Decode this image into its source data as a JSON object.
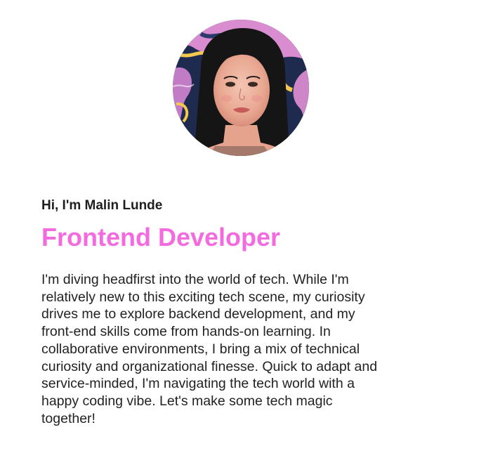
{
  "profile": {
    "greeting": "Hi, I'm Malin Lunde",
    "role": "Frontend Developer",
    "bio": "I'm diving headfirst into the world of tech. While I'm relatively new to this exciting tech scene, my curiosity drives me to explore backend development, and my front-end skills come from hands-on learning. In collaborative environments, I bring a mix of technical curiosity and organizational finesse. Quick to adapt and service-minded, I'm navigating the tech world with a happy coding vibe. Let's make some tech magic together!"
  },
  "colors": {
    "accent": "#f46be0",
    "text": "#222222",
    "background": "#ffffff"
  }
}
